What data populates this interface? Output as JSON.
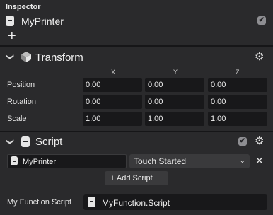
{
  "inspector": {
    "title": "Inspector",
    "object_name": "MyPrinter",
    "object_enabled_mark": "✔",
    "add_label": "+"
  },
  "transform": {
    "title": "Transform",
    "axes": [
      "X",
      "Y",
      "Z"
    ],
    "rows": [
      {
        "label": "Position",
        "values": [
          "0.00",
          "0.00",
          "0.00"
        ]
      },
      {
        "label": "Rotation",
        "values": [
          "0.00",
          "0.00",
          "0.00"
        ]
      },
      {
        "label": "Scale",
        "values": [
          "1.00",
          "1.00",
          "1.00"
        ]
      }
    ]
  },
  "script": {
    "title": "Script",
    "enabled_mark": "✔",
    "script_name": "MyPrinter",
    "event_type": "Touch Started",
    "add_button": "+ Add Script",
    "function_label": "My Function Script",
    "function_value": "MyFunction.Script"
  },
  "icons": {
    "collapse": "chevron-down-icon",
    "settings": "gear-icon",
    "remove": "close-icon",
    "transform": "cube-icon",
    "script": "script-document-icon"
  },
  "colors": {
    "panel_bg": "#2a2a2c",
    "field_bg": "#18181a",
    "button_bg": "#3a3a3c",
    "divider": "#161618",
    "checkbox": "#8e8e92"
  }
}
